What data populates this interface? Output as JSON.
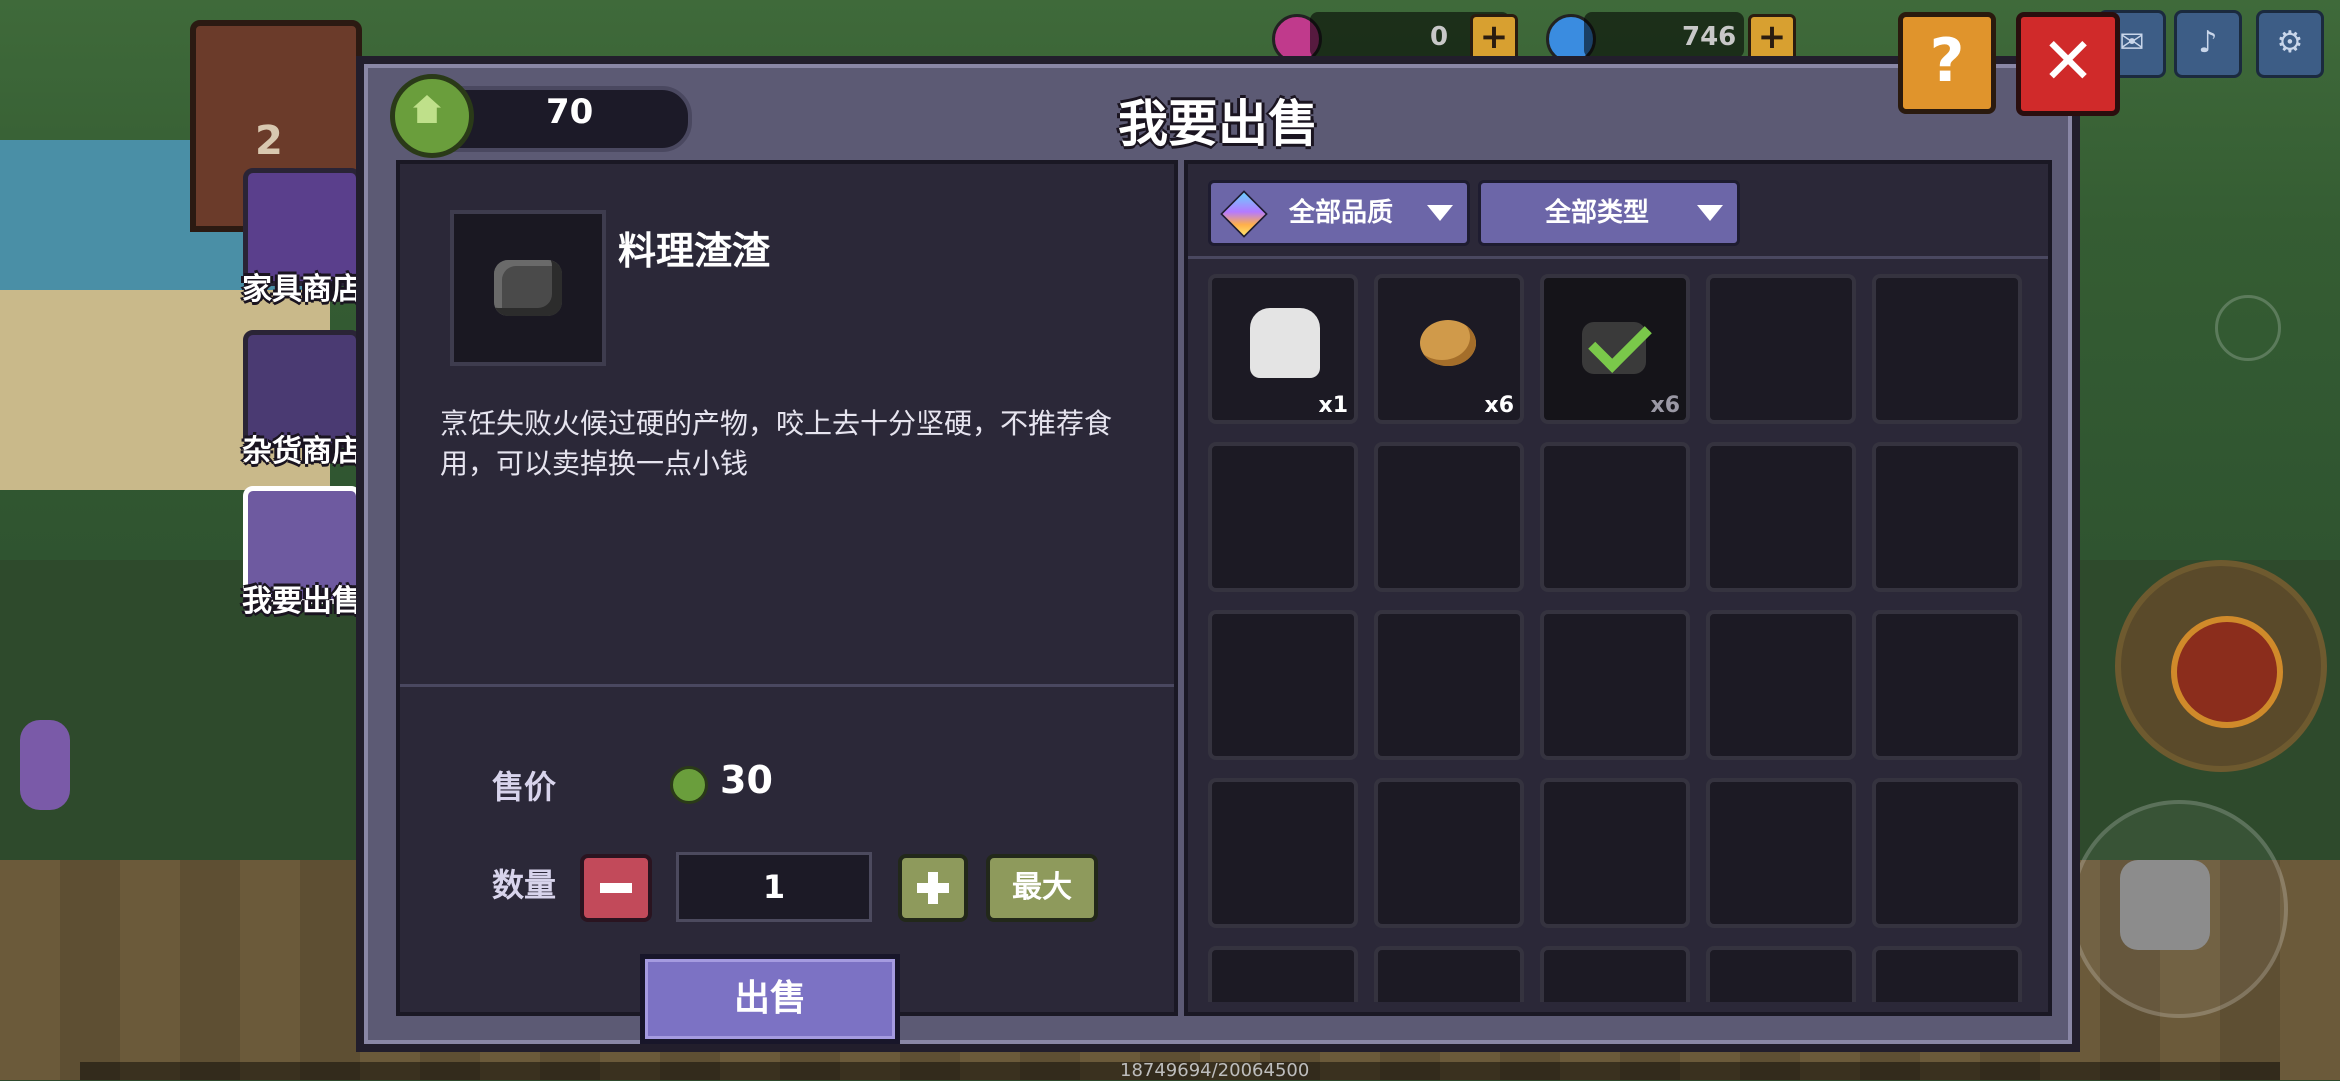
{
  "header": {
    "title": "我要出售",
    "coins": "70",
    "help_label": "?",
    "close_label": "✕"
  },
  "top_resources": {
    "res1_value": "0",
    "res2_value": "746"
  },
  "side_tabs": [
    {
      "label": "家具商店",
      "icon": "furniture-shop-icon"
    },
    {
      "label": "杂货商店",
      "icon": "grocery-shop-icon"
    },
    {
      "label": "我要出售",
      "icon": "sell-icon"
    }
  ],
  "item": {
    "name": "料理渣渣",
    "description": "烹饪失败火候过硬的产物，咬上去十分坚硬，不推荐食用，可以卖掉换一点小钱"
  },
  "sell": {
    "price_label": "售价",
    "price_value": "30",
    "qty_label": "数量",
    "qty_value": "1",
    "max_label": "最大",
    "sell_button": "出售"
  },
  "filters": {
    "quality": "全部品质",
    "type": "全部类型"
  },
  "inventory": [
    {
      "icon": "cloth-icon",
      "count": "x1"
    },
    {
      "icon": "potato-icon",
      "count": "x6"
    },
    {
      "icon": "coal-icon",
      "count": "x6",
      "selected": true
    }
  ],
  "footer": {
    "exp": "18749694/20064500"
  },
  "colors": {
    "panel": "#5c5a74",
    "inner": "#2b2838",
    "accent_purple": "#7c72c4",
    "close_red": "#d02a2a",
    "help_orange": "#e0942c",
    "plus_green": "#8e9a5c",
    "minus_red": "#c24a5a"
  }
}
